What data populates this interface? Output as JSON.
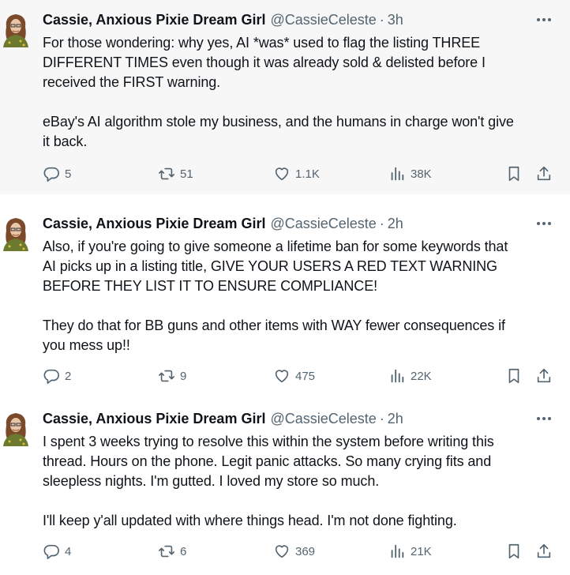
{
  "tweets": [
    {
      "name": "Cassie, Anxious Pixie Dream Girl",
      "handle": "@CassieCeleste",
      "dot": "·",
      "time": "3h",
      "text": "For those wondering: why yes, AI *was* used to flag the listing THREE\nDIFFERENT TIMES even though it was already sold & delisted before I\nreceived the FIRST warning.\n\neBay's AI algorithm stole my business, and the humans in charge won't give\nit back.",
      "replies": "5",
      "reposts": "51",
      "likes": "1.1K",
      "views": "38K"
    },
    {
      "name": "Cassie, Anxious Pixie Dream Girl",
      "handle": "@CassieCeleste",
      "dot": "·",
      "time": "2h",
      "text": "Also, if you're going to give someone a lifetime ban for some keywords that\nAI picks up in a listing title, GIVE YOUR USERS A RED TEXT WARNING\nBEFORE THEY LIST IT TO ENSURE COMPLIANCE!\n\nThey do that for BB guns and other items with WAY fewer consequences if\nyou mess up!!",
      "replies": "2",
      "reposts": "9",
      "likes": "475",
      "views": "22K"
    },
    {
      "name": "Cassie, Anxious Pixie Dream Girl",
      "handle": "@CassieCeleste",
      "dot": "·",
      "time": "2h",
      "text": "I spent 3 weeks trying to resolve this within the system before writing this\nthread. Hours on the phone. Legit panic attacks. So many crying fits and\nsleepless nights. I'm gutted. I loved my store so much.\n\nI'll keep y'all updated with where things head. I'm not done fighting.",
      "replies": "4",
      "reposts": "6",
      "likes": "369",
      "views": "21K"
    }
  ],
  "icons": {
    "reply": "reply-icon",
    "repost": "repost-icon",
    "like": "heart-icon",
    "views": "views-icon",
    "bookmark": "bookmark-icon",
    "share": "share-icon",
    "more": "more-icon"
  },
  "colors": {
    "text": "#0f1419",
    "secondary": "#536471",
    "shaded_background": "#f7f7f7"
  }
}
